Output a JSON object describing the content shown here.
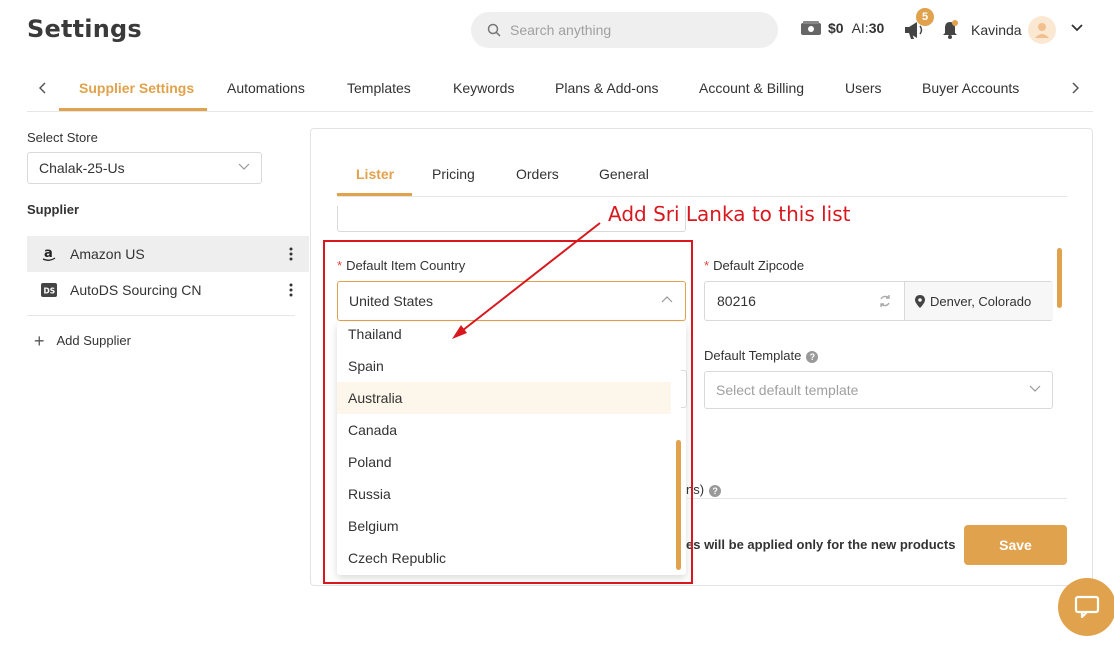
{
  "header": {
    "title": "Settings",
    "search_placeholder": "Search anything",
    "balance": "$0",
    "ai_label": "AI:",
    "ai_value": "30",
    "notifications": "5",
    "user_name": "Kavinda"
  },
  "tabs": [
    {
      "label": "Supplier Settings"
    },
    {
      "label": "Automations"
    },
    {
      "label": "Templates"
    },
    {
      "label": "Keywords"
    },
    {
      "label": "Plans & Add-ons"
    },
    {
      "label": "Account & Billing"
    },
    {
      "label": "Users"
    },
    {
      "label": "Buyer Accounts"
    }
  ],
  "sidebar": {
    "select_store_label": "Select Store",
    "store_value": "Chalak-25-Us",
    "supplier_label": "Supplier",
    "suppliers": [
      {
        "name": "Amazon US",
        "logo": "a"
      },
      {
        "name": "AutoDS Sourcing CN",
        "logo": "DS"
      }
    ],
    "add_supplier": "Add Supplier"
  },
  "subtabs": [
    {
      "label": "Lister"
    },
    {
      "label": "Pricing"
    },
    {
      "label": "Orders"
    },
    {
      "label": "General"
    }
  ],
  "form": {
    "country_label": "Default Item Country",
    "country_value": "United States",
    "country_options": [
      "Thailand",
      "Spain",
      "Australia",
      "Canada",
      "Poland",
      "Russia",
      "Belgium",
      "Czech Republic"
    ],
    "zip_label": "Default Zipcode",
    "zip_value": "80216",
    "zip_location": "Denver, Colorado",
    "template_label": "Default Template",
    "template_placeholder": "Select default template",
    "partial_label": "ns)",
    "notice": "es will be applied only for the new products",
    "save_label": "Save"
  },
  "annotation": {
    "text": "Add Sri Lanka to this list"
  },
  "colors": {
    "accent": "#e0a24c",
    "annotation": "#d8181e"
  }
}
